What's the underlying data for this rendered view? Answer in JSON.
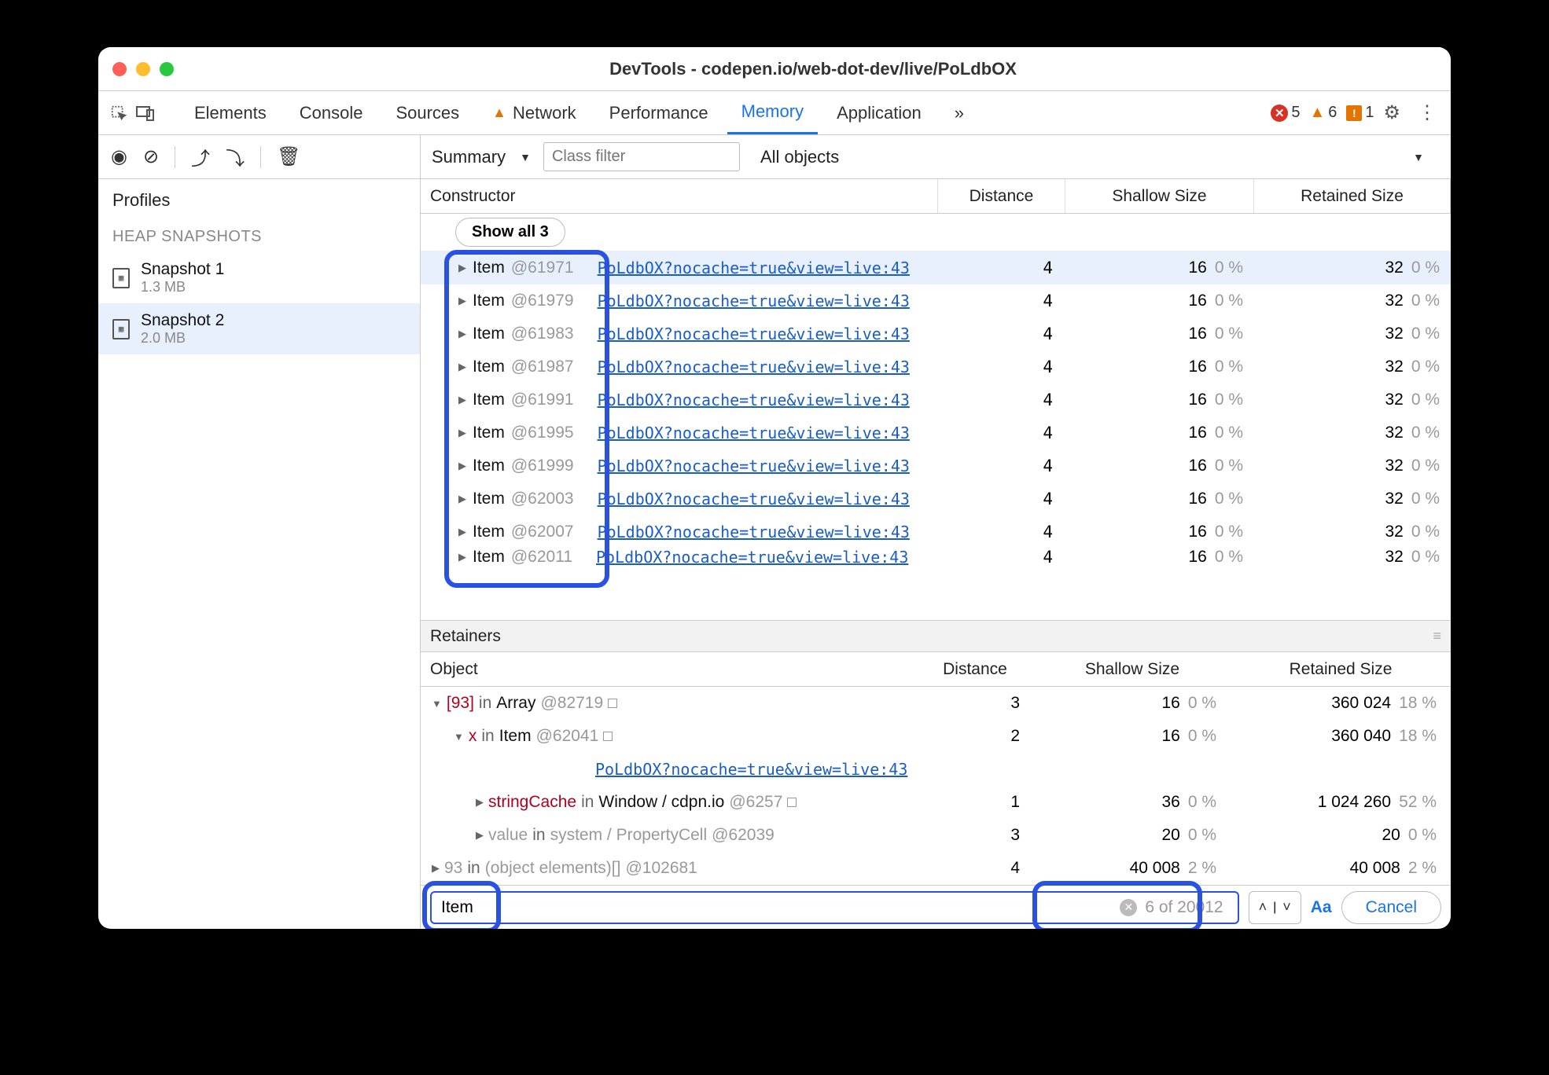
{
  "title": "DevTools - codepen.io/web-dot-dev/live/PoLdbOX",
  "tabs": {
    "elements": "Elements",
    "console": "Console",
    "sources": "Sources",
    "network": "Network",
    "performance": "Performance",
    "memory": "Memory",
    "application": "Application",
    "more": "»"
  },
  "counts": {
    "errors": "5",
    "warnings": "6",
    "issues": "1"
  },
  "sidebar": {
    "profiles": "Profiles",
    "heap": "HEAP SNAPSHOTS",
    "snaps": [
      {
        "name": "Snapshot 1",
        "size": "1.3 MB"
      },
      {
        "name": "Snapshot 2",
        "size": "2.0 MB"
      }
    ]
  },
  "toolbar": {
    "summary": "Summary",
    "filter_ph": "Class filter",
    "allobj": "All objects"
  },
  "headers": {
    "constructor": "Constructor",
    "distance": "Distance",
    "shallow": "Shallow Size",
    "retained": "Retained Size"
  },
  "showall": "Show all 3",
  "rows": [
    {
      "name": "Item",
      "id": "@61971",
      "link": "PoLdbOX?nocache=true&view=live:43",
      "d": "4",
      "sh": "16",
      "shp": "0 %",
      "rt": "32",
      "rtp": "0 %",
      "sel": true
    },
    {
      "name": "Item",
      "id": "@61979",
      "link": "PoLdbOX?nocache=true&view=live:43",
      "d": "4",
      "sh": "16",
      "shp": "0 %",
      "rt": "32",
      "rtp": "0 %"
    },
    {
      "name": "Item",
      "id": "@61983",
      "link": "PoLdbOX?nocache=true&view=live:43",
      "d": "4",
      "sh": "16",
      "shp": "0 %",
      "rt": "32",
      "rtp": "0 %"
    },
    {
      "name": "Item",
      "id": "@61987",
      "link": "PoLdbOX?nocache=true&view=live:43",
      "d": "4",
      "sh": "16",
      "shp": "0 %",
      "rt": "32",
      "rtp": "0 %"
    },
    {
      "name": "Item",
      "id": "@61991",
      "link": "PoLdbOX?nocache=true&view=live:43",
      "d": "4",
      "sh": "16",
      "shp": "0 %",
      "rt": "32",
      "rtp": "0 %"
    },
    {
      "name": "Item",
      "id": "@61995",
      "link": "PoLdbOX?nocache=true&view=live:43",
      "d": "4",
      "sh": "16",
      "shp": "0 %",
      "rt": "32",
      "rtp": "0 %"
    },
    {
      "name": "Item",
      "id": "@61999",
      "link": "PoLdbOX?nocache=true&view=live:43",
      "d": "4",
      "sh": "16",
      "shp": "0 %",
      "rt": "32",
      "rtp": "0 %"
    },
    {
      "name": "Item",
      "id": "@62003",
      "link": "PoLdbOX?nocache=true&view=live:43",
      "d": "4",
      "sh": "16",
      "shp": "0 %",
      "rt": "32",
      "rtp": "0 %"
    },
    {
      "name": "Item",
      "id": "@62007",
      "link": "PoLdbOX?nocache=true&view=live:43",
      "d": "4",
      "sh": "16",
      "shp": "0 %",
      "rt": "32",
      "rtp": "0 %"
    },
    {
      "name": "Item",
      "id": "@62011",
      "link": "PoLdbOX?nocache=true&view=live:43",
      "d": "4",
      "sh": "16",
      "shp": "0 %",
      "rt": "32",
      "rtp": "0 %",
      "cut": true
    }
  ],
  "retainers_label": "Retainers",
  "rheaders": {
    "object": "Object",
    "distance": "Distance",
    "shallow": "Shallow Size",
    "retained": "Retained Size"
  },
  "retainers": [
    {
      "pad": 0,
      "tri": "▼",
      "html": "<span class='idx'>[93]</span> <span class='in'>in</span> <span class='name'>Array</span> <span class='oid'>@82719</span> <span class='box'></span>",
      "d": "3",
      "sh": "16",
      "shp": "0 %",
      "rt": "360 024",
      "rtp": "18 %"
    },
    {
      "pad": 28,
      "tri": "▼",
      "html": "<span class='key'>x</span> <span class='in'>in</span> <span class='name'>Item</span> <span class='oid'>@62041</span> <span class='box'></span>",
      "d": "2",
      "sh": "16",
      "shp": "0 %",
      "rt": "360 040",
      "rtp": "18 %"
    },
    {
      "linkonly": "PoLdbOX?nocache=true&view=live:43"
    },
    {
      "pad": 56,
      "tri": "▶",
      "html": "<span class='key'>stringCache</span> <span class='in'>in</span> <span class='name'>Window / cdpn.io</span> <span class='oid'>@6257</span> <span class='box'></span>",
      "d": "1",
      "sh": "36",
      "shp": "0 %",
      "rt": "1 024 260",
      "rtp": "52 %"
    },
    {
      "pad": 56,
      "tri": "▶",
      "dim": true,
      "html": "<span>value</span> <span class='in'>in</span> <span>system / PropertyCell</span> <span class='oid'>@62039</span>",
      "d": "3",
      "sh": "20",
      "shp": "0 %",
      "rt": "20",
      "rtp": "0 %"
    },
    {
      "pad": 0,
      "tri": "▶",
      "dim": true,
      "html": "<span>93</span> <span class='in'>in</span> <span>(object elements)[]</span> <span class='oid'>@102681</span>",
      "d": "4",
      "sh": "40 008",
      "shp": "2 %",
      "rt": "40 008",
      "rtp": "2 %"
    }
  ],
  "search": {
    "value": "Item",
    "count": "6 of 20012",
    "aa": "Aa",
    "cancel": "Cancel"
  }
}
